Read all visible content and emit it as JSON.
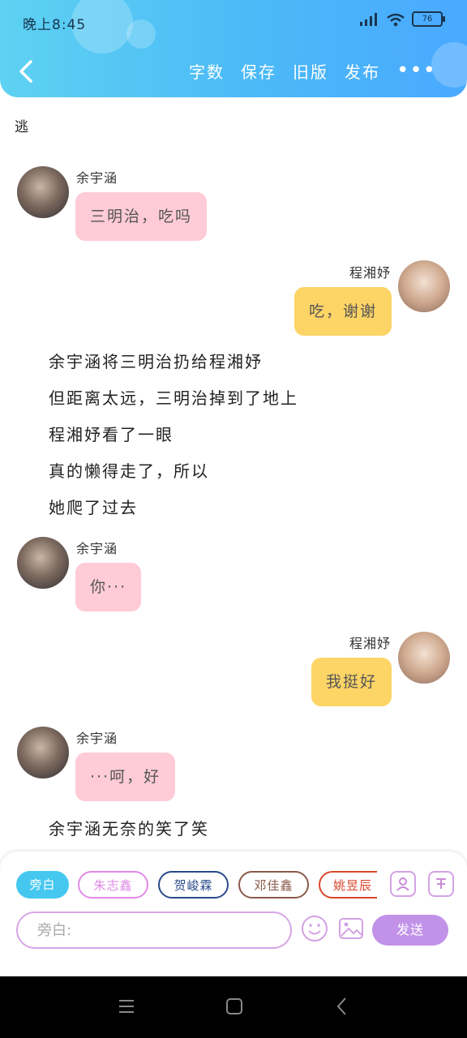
{
  "status": {
    "time": "晚上8:45",
    "battery": "76"
  },
  "header": {
    "menu": [
      "字数",
      "保存",
      "旧版",
      "发布"
    ],
    "more": "•••"
  },
  "chat": {
    "top_text": "逃",
    "messages": [
      {
        "speaker": "余宇涵",
        "text": "三明治，吃吗"
      },
      {
        "speaker": "程湘妤",
        "text": "吃，谢谢"
      },
      {
        "speaker": "余宇涵",
        "text": "你···"
      },
      {
        "speaker": "程湘妤",
        "text": "我挺好"
      },
      {
        "speaker": "余宇涵",
        "text": "···呵，好"
      }
    ],
    "narration1": [
      "余宇涵将三明治扔给程湘妤",
      "但距离太远，三明治掉到了地上",
      "程湘妤看了一眼",
      "真的懒得走了，所以",
      "她爬了过去"
    ],
    "narration2": "余宇涵无奈的笑了笑"
  },
  "panel": {
    "chips": [
      {
        "label": "旁白",
        "color": "#45c8ef"
      },
      {
        "label": "朱志鑫",
        "color": "#e08ae6"
      },
      {
        "label": "贺峻霖",
        "color": "#2a4a8a"
      },
      {
        "label": "邓佳鑫",
        "color": "#8a5a4a"
      },
      {
        "label": "姚昱辰",
        "color": "#d9462a"
      }
    ],
    "input_placeholder": "旁白:",
    "send_label": "发送"
  }
}
